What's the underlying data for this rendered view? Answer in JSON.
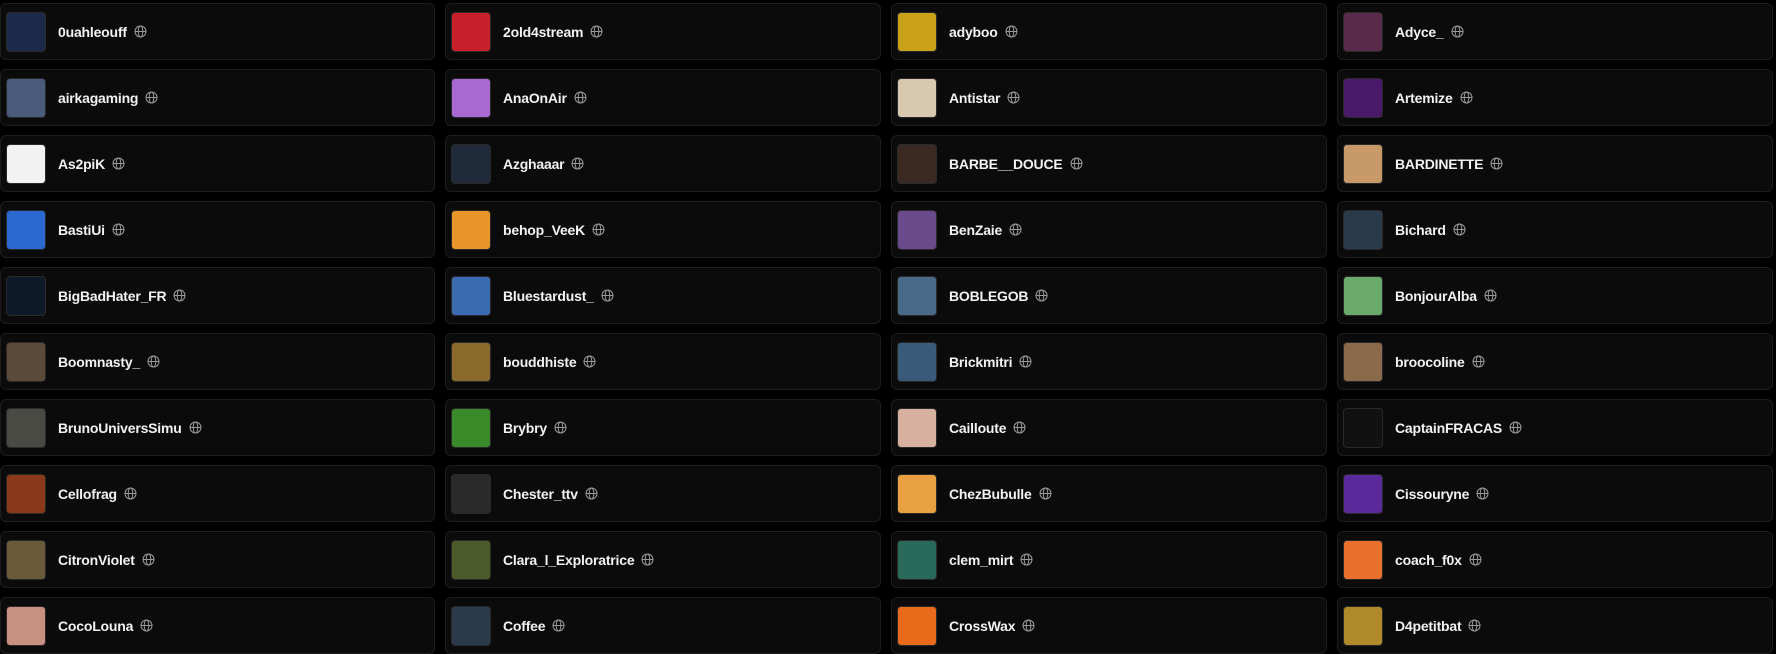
{
  "icons": {
    "globe": "globe-icon"
  },
  "colors": {
    "background": "#000000",
    "card_background": "#0b0b0b",
    "card_border": "#1d1d1d",
    "text": "#f2f2f2",
    "icon": "#9a9a9a"
  },
  "streamers": [
    {
      "name": "0uahleouff",
      "avatar_color": "#1b2a4a"
    },
    {
      "name": "2old4stream",
      "avatar_color": "#c8202a"
    },
    {
      "name": "adyboo",
      "avatar_color": "#c9a21a"
    },
    {
      "name": "Adyce_",
      "avatar_color": "#5a2a4a"
    },
    {
      "name": "airkagaming",
      "avatar_color": "#4a5a7a"
    },
    {
      "name": "AnaOnAir",
      "avatar_color": "#a86ad0"
    },
    {
      "name": "Antistar",
      "avatar_color": "#d8c8b0"
    },
    {
      "name": "Artemize",
      "avatar_color": "#4a1a6a"
    },
    {
      "name": "As2piK",
      "avatar_color": "#f2f2f2"
    },
    {
      "name": "Azghaaar",
      "avatar_color": "#1e2a3a"
    },
    {
      "name": "BARBE__DOUCE",
      "avatar_color": "#3a2a22"
    },
    {
      "name": "BARDINETTE",
      "avatar_color": "#c89a6a"
    },
    {
      "name": "BastiUi",
      "avatar_color": "#2a6ad0"
    },
    {
      "name": "behop_VeeK",
      "avatar_color": "#e8962a"
    },
    {
      "name": "BenZaie",
      "avatar_color": "#6a4a8a"
    },
    {
      "name": "Bichard",
      "avatar_color": "#2a3a4a"
    },
    {
      "name": "BigBadHater_FR",
      "avatar_color": "#0e1a2a"
    },
    {
      "name": "Bluestardust_",
      "avatar_color": "#3a6ab0"
    },
    {
      "name": "BOBLEGOB",
      "avatar_color": "#4a6a8a"
    },
    {
      "name": "BonjourAlba",
      "avatar_color": "#6aaa6a"
    },
    {
      "name": "Boomnasty_",
      "avatar_color": "#5a4a3a"
    },
    {
      "name": "bouddhiste",
      "avatar_color": "#8a6a2a"
    },
    {
      "name": "Brickmitri",
      "avatar_color": "#3a5a7a"
    },
    {
      "name": "broocoline",
      "avatar_color": "#8a6a4a"
    },
    {
      "name": "BrunoUniversSimu",
      "avatar_color": "#4a4a44"
    },
    {
      "name": "Brybry",
      "avatar_color": "#3a8a2a"
    },
    {
      "name": "Cailloute",
      "avatar_color": "#d8b0a0"
    },
    {
      "name": "CaptainFRACAS",
      "avatar_color": "#111111"
    },
    {
      "name": "Cellofrag",
      "avatar_color": "#8a3a1a"
    },
    {
      "name": "Chester_ttv",
      "avatar_color": "#2a2a2a"
    },
    {
      "name": "ChezBubulle",
      "avatar_color": "#e8a040"
    },
    {
      "name": "Cissouryne",
      "avatar_color": "#5a2a9a"
    },
    {
      "name": "CitronViolet",
      "avatar_color": "#6a5a3a"
    },
    {
      "name": "Clara_l_Exploratrice",
      "avatar_color": "#4a5a2a"
    },
    {
      "name": "clem_mirt",
      "avatar_color": "#2a6a5a"
    },
    {
      "name": "coach_f0x",
      "avatar_color": "#e8702a"
    },
    {
      "name": "CocoLouna",
      "avatar_color": "#c89080"
    },
    {
      "name": "Coffee",
      "avatar_color": "#2a3a4a"
    },
    {
      "name": "CrossWax",
      "avatar_color": "#e86a1a"
    },
    {
      "name": "D4petitbat",
      "avatar_color": "#b08a2a"
    }
  ]
}
